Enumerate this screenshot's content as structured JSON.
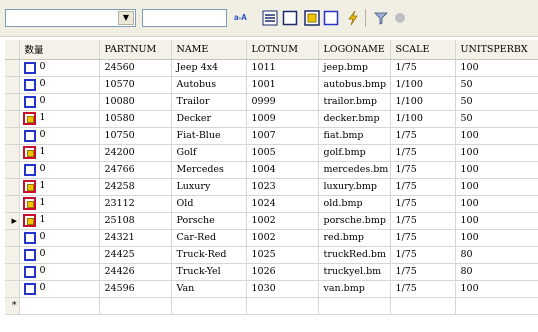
{
  "toolbar": {
    "combo1_value": "",
    "combo2_value": "",
    "sort_label": "a-A"
  },
  "grid": {
    "columns": [
      "数量",
      "PARTNUM",
      "NAME",
      "LOTNUM",
      "LOGONAME",
      "SCALE",
      "UNITSPERBX"
    ],
    "rows": [
      {
        "qty": "0",
        "partnum": "24560",
        "name": "Jeep 4x4",
        "lotnum": "1011",
        "logo": "jeep.bmp",
        "scale": "1/75",
        "units": "100",
        "checked": false
      },
      {
        "qty": "0",
        "partnum": "10570",
        "name": "Autobus",
        "lotnum": "1001",
        "logo": "autobus.bmp",
        "scale": "1/100",
        "units": "50",
        "checked": false
      },
      {
        "qty": "0",
        "partnum": "10080",
        "name": "Trailor",
        "lotnum": "0999",
        "logo": "trailor.bmp",
        "scale": "1/100",
        "units": "50",
        "checked": false
      },
      {
        "qty": "1",
        "partnum": "10580",
        "name": "Decker",
        "lotnum": "1009",
        "logo": "decker.bmp",
        "scale": "1/100",
        "units": "50",
        "checked": true
      },
      {
        "qty": "0",
        "partnum": "10750",
        "name": "Fiat-Blue",
        "lotnum": "1007",
        "logo": "fiat.bmp",
        "scale": "1/75",
        "units": "100",
        "checked": false
      },
      {
        "qty": "1",
        "partnum": "24200",
        "name": "Golf",
        "lotnum": "1005",
        "logo": "golf.bmp",
        "scale": "1/75",
        "units": "100",
        "checked": true
      },
      {
        "qty": "0",
        "partnum": "24766",
        "name": "Mercedes",
        "lotnum": "1004",
        "logo": "mercedes.bm",
        "scale": "1/75",
        "units": "100",
        "checked": false
      },
      {
        "qty": "1",
        "partnum": "24258",
        "name": "Luxury",
        "lotnum": "1023",
        "logo": "luxury.bmp",
        "scale": "1/75",
        "units": "100",
        "checked": true
      },
      {
        "qty": "1",
        "partnum": "23112",
        "name": "Old",
        "lotnum": "1024",
        "logo": "old.bmp",
        "scale": "1/75",
        "units": "100",
        "checked": true
      },
      {
        "qty": "1",
        "partnum": "25108",
        "name": "Porsche",
        "lotnum": "1002",
        "logo": "porsche.bmp",
        "scale": "1/75",
        "units": "100",
        "checked": true,
        "current": true
      },
      {
        "qty": "0",
        "partnum": "24321",
        "name": "Car-Red",
        "lotnum": "1002",
        "logo": "red.bmp",
        "scale": "1/75",
        "units": "100",
        "checked": false
      },
      {
        "qty": "0",
        "partnum": "24425",
        "name": "Truck-Red",
        "lotnum": "1025",
        "logo": "truckRed.bm",
        "scale": "1/75",
        "units": "80",
        "checked": false
      },
      {
        "qty": "0",
        "partnum": "24426",
        "name": "Truck-Yel",
        "lotnum": "1026",
        "logo": "truckyel.bm",
        "scale": "1/75",
        "units": "80",
        "checked": false
      },
      {
        "qty": "0",
        "partnum": "24596",
        "name": "Van",
        "lotnum": "1030",
        "logo": "van.bmp",
        "scale": "1/75",
        "units": "100",
        "checked": false
      }
    ],
    "new_row_marker": "*"
  }
}
